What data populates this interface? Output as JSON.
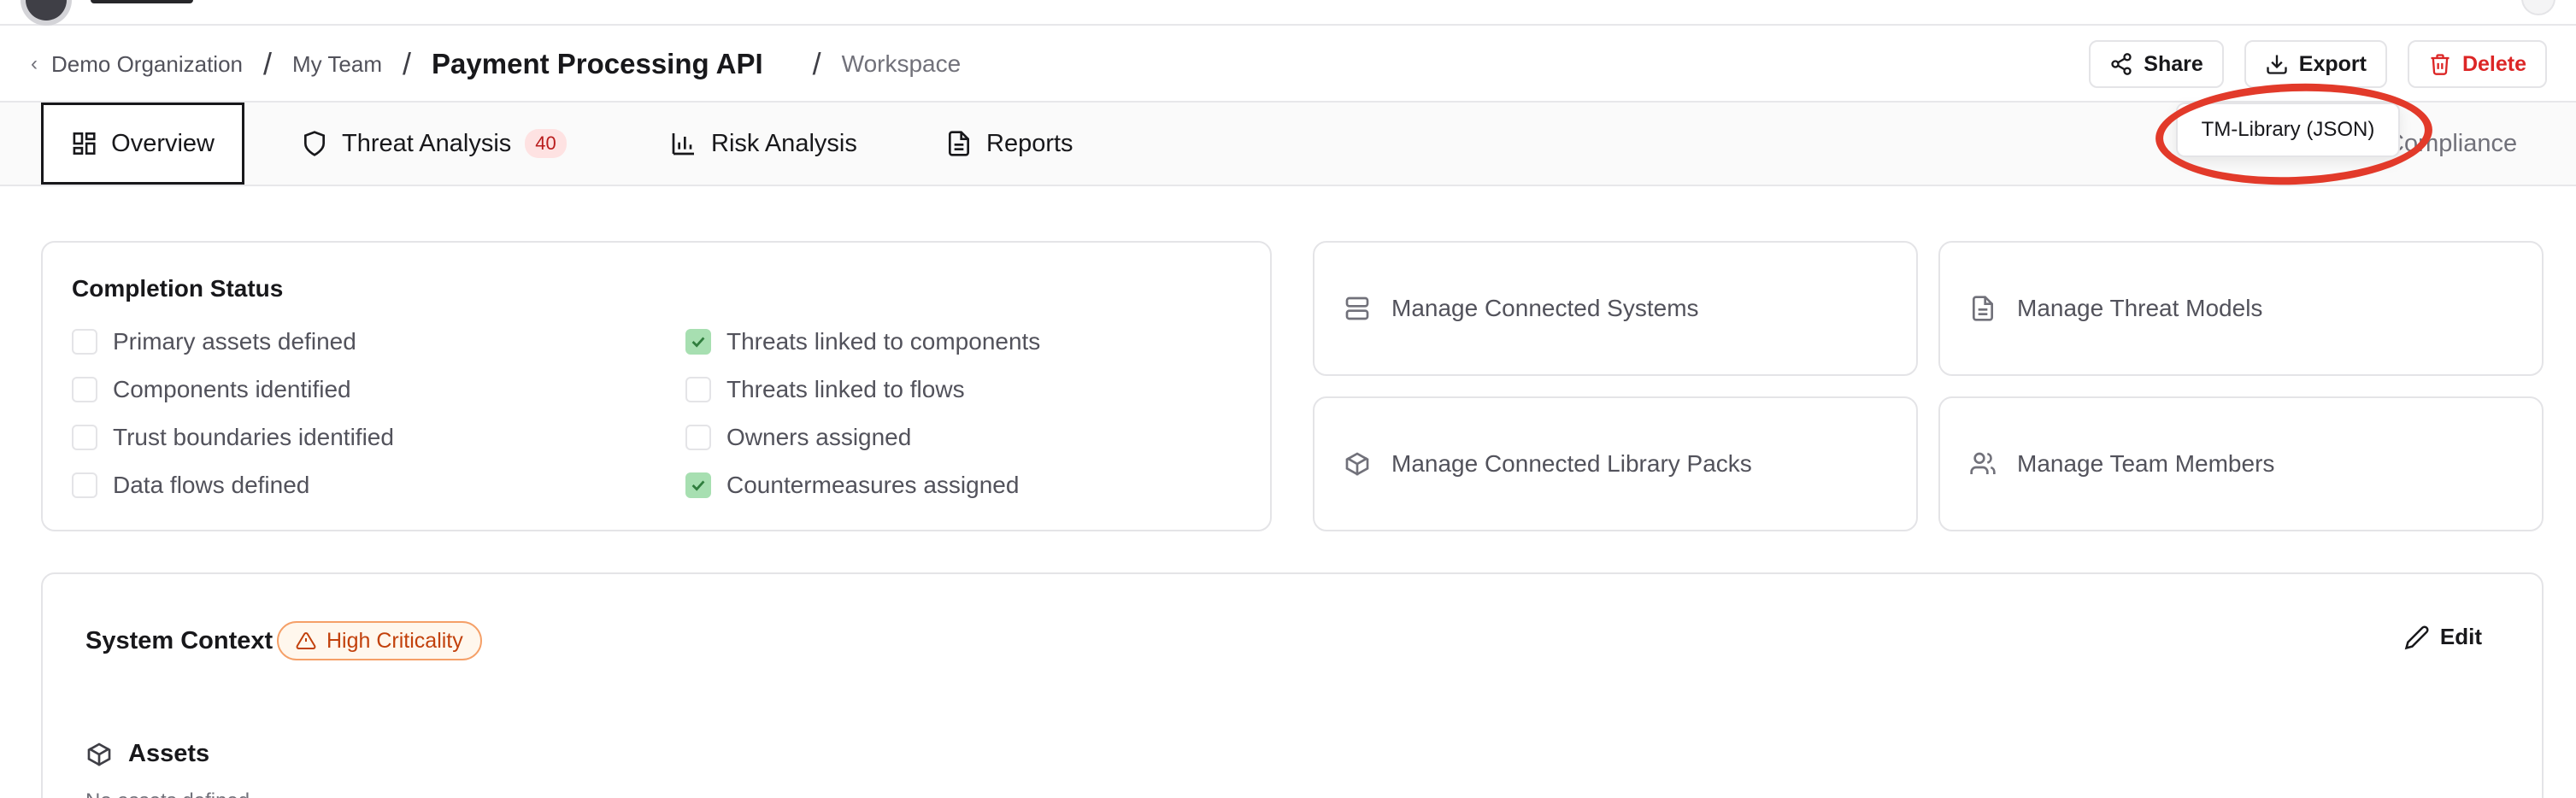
{
  "breadcrumb": {
    "org": "Demo Organization",
    "team": "My Team",
    "title": "Payment Processing API",
    "section": "Workspace"
  },
  "actions": {
    "share": "Share",
    "export": "Export",
    "delete": "Delete"
  },
  "export_menu": {
    "items": [
      "TM-Library (JSON)"
    ]
  },
  "tabs": [
    {
      "label": "Overview",
      "active": true
    },
    {
      "label": "Threat Analysis",
      "badge": "40"
    },
    {
      "label": "Risk Analysis"
    },
    {
      "label": "Reports"
    },
    {
      "label": "Compliance"
    }
  ],
  "completion": {
    "title": "Completion Status",
    "items": [
      {
        "label": "Primary assets defined",
        "checked": false
      },
      {
        "label": "Components identified",
        "checked": false
      },
      {
        "label": "Trust boundaries identified",
        "checked": false
      },
      {
        "label": "Data flows defined",
        "checked": false
      },
      {
        "label": "Threats linked to components",
        "checked": true
      },
      {
        "label": "Threats linked to flows",
        "checked": false
      },
      {
        "label": "Owners assigned",
        "checked": false
      },
      {
        "label": "Countermeasures assigned",
        "checked": true
      }
    ]
  },
  "manage": {
    "systems": "Manage Connected Systems",
    "threat_models": "Manage Threat Models",
    "library_packs": "Manage Connected Library Packs",
    "team_members": "Manage Team Members"
  },
  "context": {
    "title": "System Context",
    "criticality": "High Criticality",
    "edit": "Edit",
    "assets_title": "Assets",
    "assets_empty": "No assets defined"
  },
  "colors": {
    "accent_danger": "#dc2626",
    "check_fill": "#a7dfb1",
    "badge_bg": "#fee2e2",
    "criticality": "#c2410c",
    "annotation": "#e23a2a"
  }
}
